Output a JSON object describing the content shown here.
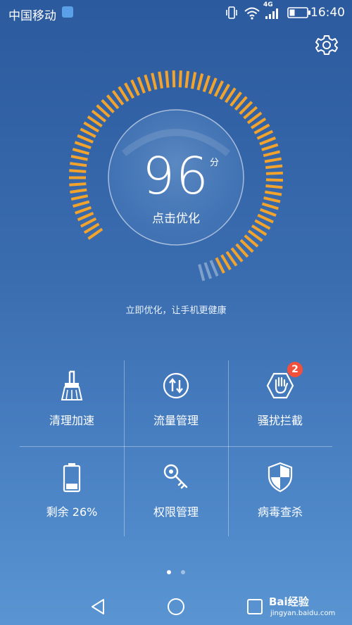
{
  "status_bar": {
    "carrier": "中国移动",
    "network": "4G",
    "time": "16:40"
  },
  "main": {
    "score": "96",
    "score_unit": "分",
    "optimize_label": "点击优化",
    "subtitle": "立即优化，让手机更健康"
  },
  "grid": {
    "items": [
      {
        "label": "清理加速",
        "icon": "broom-icon"
      },
      {
        "label": "流量管理",
        "icon": "data-transfer-icon"
      },
      {
        "label": "骚扰拦截",
        "icon": "stop-hand-icon",
        "badge": "2"
      },
      {
        "label": "剩余 26%",
        "icon": "battery-icon",
        "level": 0.26
      },
      {
        "label": "权限管理",
        "icon": "key-icon"
      },
      {
        "label": "病毒查杀",
        "icon": "shield-icon"
      }
    ]
  },
  "pager": {
    "active_page": 1,
    "page_count": 2
  },
  "watermark": {
    "brand": "Bai经验",
    "url": "jingyan.baidu.com"
  },
  "colors": {
    "gauge": "#f2a32c",
    "badge": "#f0503c",
    "background_top": "#2c5a9e",
    "background_bottom": "#5a95d2"
  }
}
